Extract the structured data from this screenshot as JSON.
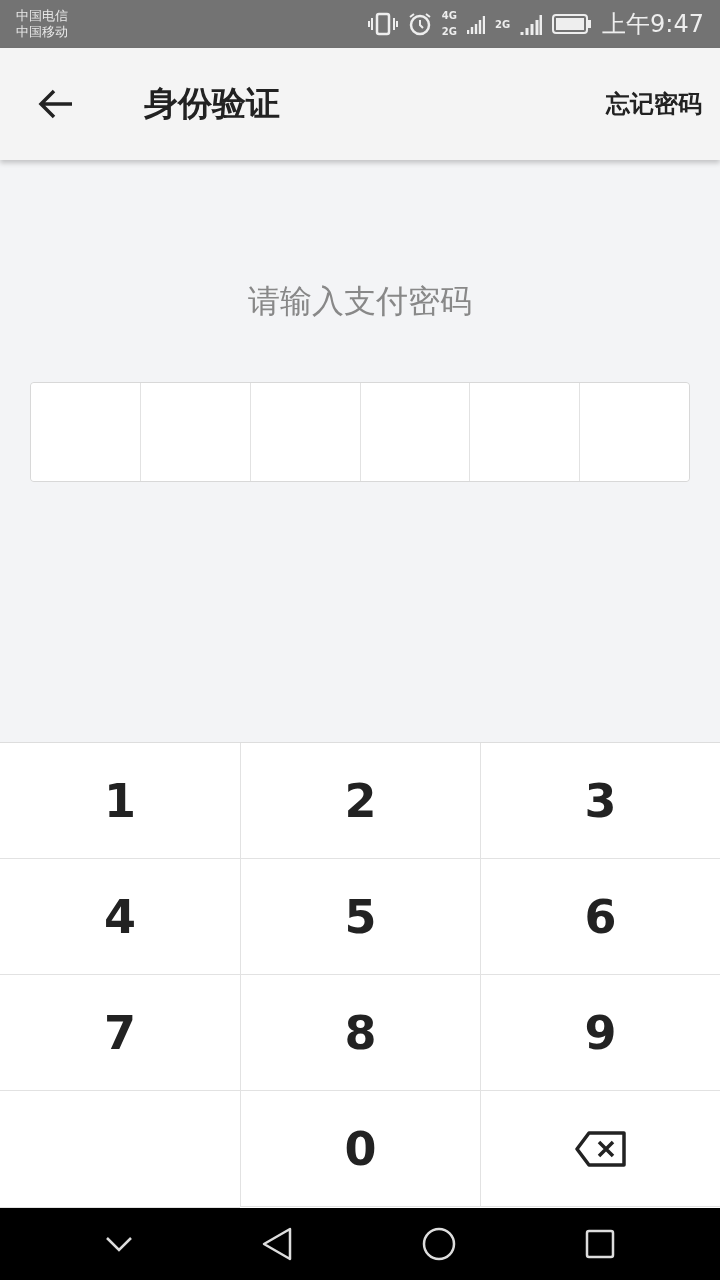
{
  "status_bar": {
    "carriers": [
      "中国电信",
      "中国移动"
    ],
    "network_labels": [
      "4G",
      "2G",
      "2G"
    ],
    "time": "上午9:47"
  },
  "header": {
    "title": "身份验证",
    "action": "忘记密码"
  },
  "prompt": "请输入支付密码",
  "password_cells": [
    {
      "filled": false
    },
    {
      "filled": false
    },
    {
      "filled": false
    },
    {
      "filled": false
    },
    {
      "filled": false
    },
    {
      "filled": false
    }
  ],
  "keypad": [
    {
      "kind": "digit",
      "label": "1"
    },
    {
      "kind": "digit",
      "label": "2"
    },
    {
      "kind": "digit",
      "label": "3"
    },
    {
      "kind": "digit",
      "label": "4"
    },
    {
      "kind": "digit",
      "label": "5"
    },
    {
      "kind": "digit",
      "label": "6"
    },
    {
      "kind": "digit",
      "label": "7"
    },
    {
      "kind": "digit",
      "label": "8"
    },
    {
      "kind": "digit",
      "label": "9"
    },
    {
      "kind": "empty"
    },
    {
      "kind": "digit",
      "label": "0"
    },
    {
      "kind": "backspace"
    }
  ]
}
